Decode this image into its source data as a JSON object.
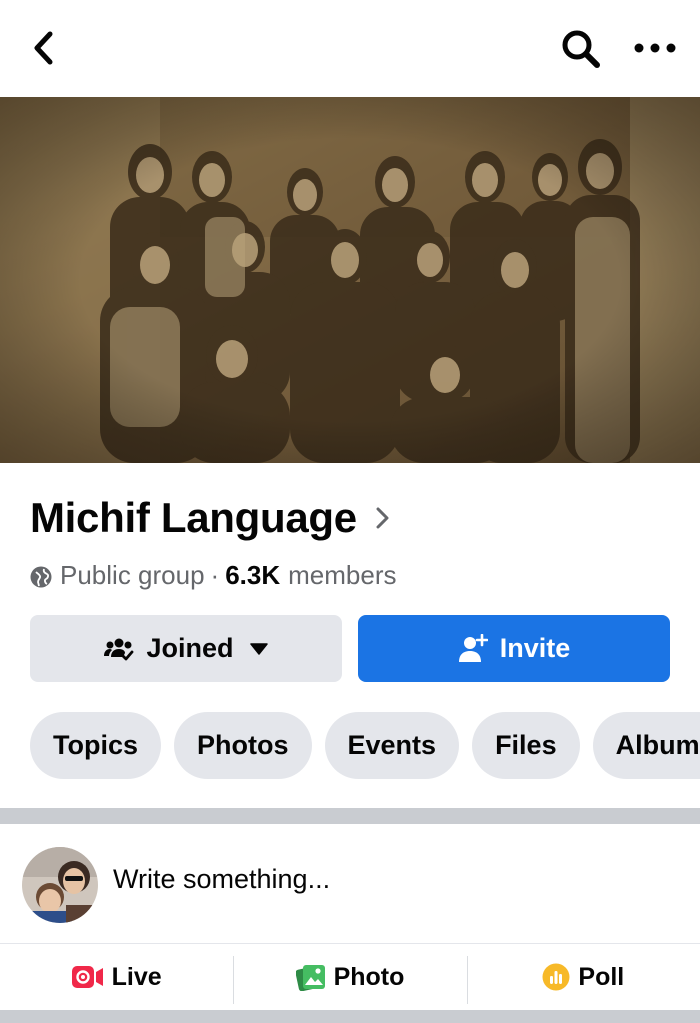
{
  "header": {
    "back_icon": "chevron-left-icon",
    "search_icon": "search-icon",
    "more_icon": "more-horizontal-icon"
  },
  "cover": {
    "description_icon": "group-cover-photo"
  },
  "group": {
    "name": "Michif Language",
    "privacy": "Public group",
    "separator": "·",
    "member_count": "6.3K",
    "members_label": "members"
  },
  "buttons": {
    "joined_label": "Joined",
    "invite_label": "Invite"
  },
  "tabs": [
    {
      "label": "Topics"
    },
    {
      "label": "Photos"
    },
    {
      "label": "Events"
    },
    {
      "label": "Files"
    },
    {
      "label": "Albums"
    }
  ],
  "composer": {
    "placeholder": "Write something..."
  },
  "actions": {
    "live_label": "Live",
    "photo_label": "Photo",
    "poll_label": "Poll"
  },
  "colors": {
    "primary_blue": "#1b74e4",
    "button_gray": "#e4e6eb",
    "live_red": "#f02849",
    "photo_green": "#45bd62",
    "poll_orange": "#f7b928"
  }
}
